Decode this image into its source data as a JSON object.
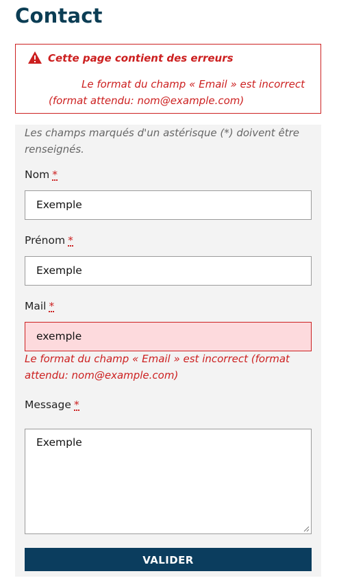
{
  "page": {
    "title": "Contact"
  },
  "errors": {
    "title": "Cette page contient des erreurs",
    "message": "Le format du champ « Email » est incorrect (format attendu: nom@example.com)"
  },
  "form": {
    "required_note": "Les champs marqués d'un astérisque (*) doivent être renseignés.",
    "required_marker": "*",
    "nom": {
      "label": "Nom",
      "value": "Exemple"
    },
    "prenom": {
      "label": "Prénom",
      "value": "Exemple"
    },
    "mail": {
      "label": "Mail",
      "value": "exemple",
      "error": "Le format du champ « Email » est incorrect (format attendu: nom@example.com)"
    },
    "message": {
      "label": "Message",
      "value": "Exemple"
    },
    "submit_label": "VALIDER"
  },
  "colors": {
    "title": "#0b3d54",
    "error": "#cc1f1f",
    "invalid_bg": "#fddadd",
    "form_bg": "#f3f3f3",
    "button_bg": "#0b3d5e"
  },
  "icons": {
    "error_banner": "warning-triangle-icon",
    "textarea_resize": "resize-grip-icon"
  }
}
